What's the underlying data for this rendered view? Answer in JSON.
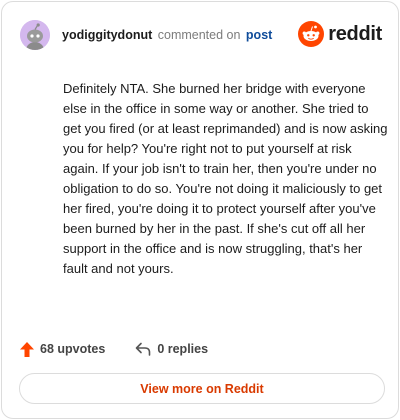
{
  "header": {
    "username": "yodiggitydonut",
    "action_text": "commented on",
    "post_link": "post",
    "logo_text": "reddit",
    "avatar_icon": "snoo-avatar-icon",
    "brand_color": "#ff4500"
  },
  "comment": {
    "text": "Definitely NTA. She burned her bridge with everyone else in the office in some way or another. She tried to get you fired (or at least reprimanded) and is now asking you for help? You're right not to put yourself at risk again. If your job isn't to train her, then you're under no obligation to do so. You're not doing it maliciously to get her fired, you're doing it to protect yourself after you've been burned by her in the past. If she's cut off all her support in the office and is now struggling, that's her fault and not yours."
  },
  "footer": {
    "upvotes": "68 upvotes",
    "upvote_icon": "upvote-arrow-icon",
    "replies": "0 replies",
    "reply_icon": "reply-arrow-icon",
    "view_more": "View more on Reddit"
  }
}
